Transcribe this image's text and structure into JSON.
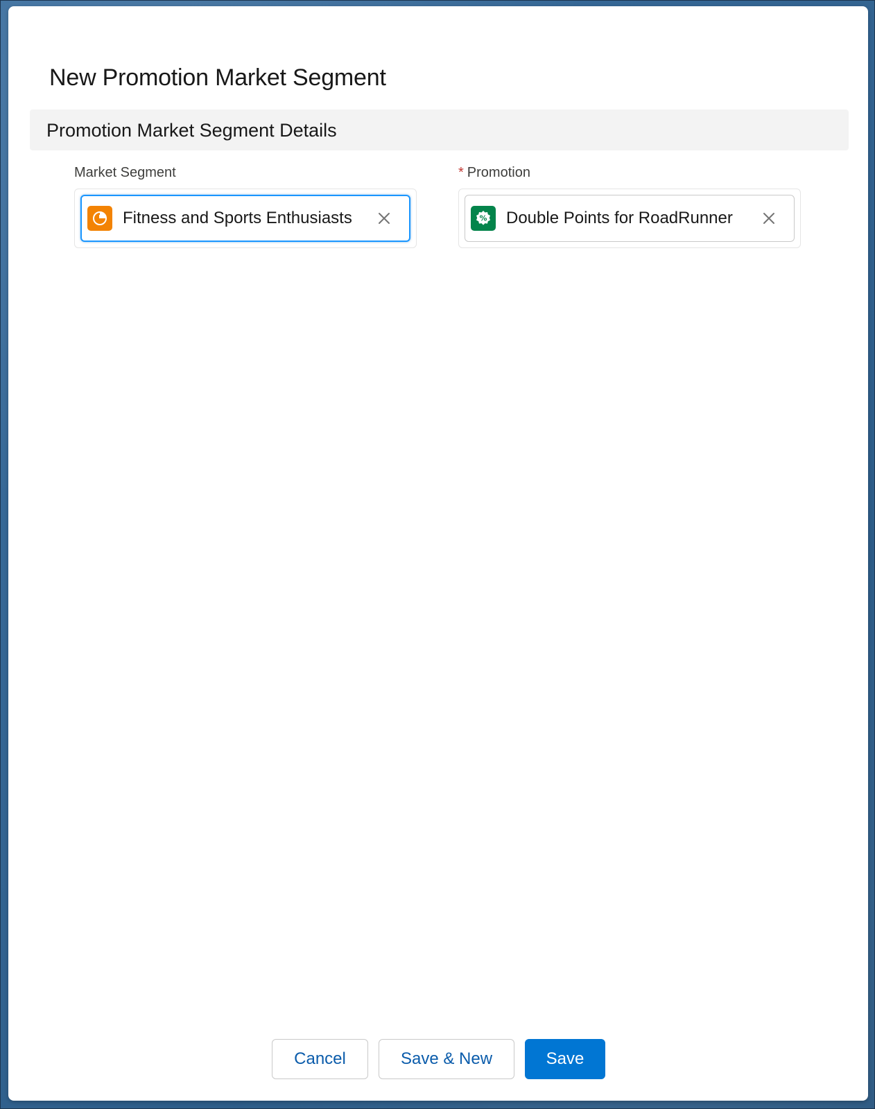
{
  "modal": {
    "title": "New Promotion Market Segment"
  },
  "section": {
    "title": "Promotion Market Segment Details"
  },
  "fields": {
    "market_segment": {
      "label": "Market Segment",
      "value": "Fitness and Sports Enthusiasts",
      "icon": "market-segment-icon",
      "icon_color": "#f38303"
    },
    "promotion": {
      "label": "Promotion",
      "required_marker": "*",
      "value": "Double Points for RoadRunner",
      "icon": "promotion-icon",
      "icon_color": "#04844b"
    }
  },
  "buttons": {
    "cancel": "Cancel",
    "save_new": "Save & New",
    "save": "Save"
  },
  "colors": {
    "brand": "#0176d3",
    "required": "#c23934",
    "focus": "#1b96ff"
  }
}
